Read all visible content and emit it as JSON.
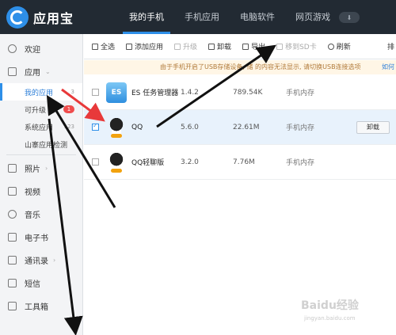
{
  "app": {
    "name": "应用宝"
  },
  "nav": {
    "tabs": [
      {
        "label": "我的手机",
        "active": true
      },
      {
        "label": "手机应用"
      },
      {
        "label": "电脑软件"
      },
      {
        "label": "网页游戏"
      }
    ],
    "download_icon": "download-icon"
  },
  "sidebar": {
    "items": [
      {
        "label": "欢迎",
        "icon": "welcome-icon"
      },
      {
        "label": "应用",
        "icon": "apps-grid-icon"
      },
      {
        "label": "照片",
        "icon": "photo-icon"
      },
      {
        "label": "视频",
        "icon": "video-icon"
      },
      {
        "label": "音乐",
        "icon": "music-icon"
      },
      {
        "label": "电子书",
        "icon": "ebook-icon"
      },
      {
        "label": "通讯录",
        "icon": "contacts-icon"
      },
      {
        "label": "短信",
        "icon": "sms-icon"
      },
      {
        "label": "工具箱",
        "icon": "toolbox-icon"
      }
    ],
    "sub_items": [
      {
        "label": "我的应用",
        "count": "3",
        "active": true
      },
      {
        "label": "可升级",
        "badge": "1"
      },
      {
        "label": "系统应用",
        "count": "123"
      },
      {
        "label": "山寨应用检测"
      }
    ]
  },
  "toolbar": {
    "select_all": "全选",
    "add_app": "添加应用",
    "upgrade": "升级",
    "uninstall": "卸载",
    "export": "导出",
    "move_sd": "移到SD卡",
    "refresh": "刷新",
    "sort": "排"
  },
  "notice": {
    "text": "由于手机开启了USB存储设备, 储                        的内容无法显示, 请切换USB连接选项",
    "link": "如何"
  },
  "apps": [
    {
      "name": "ES 任务管理器",
      "version": "1.4.2",
      "size": "789.54K",
      "location": "手机内存",
      "checked": false,
      "icon": "es-task-manager-icon"
    },
    {
      "name": "QQ",
      "version": "5.6.0",
      "size": "22.61M",
      "location": "手机内存",
      "checked": true,
      "action": "卸载",
      "icon": "qq-icon"
    },
    {
      "name": "QQ轻聊版",
      "version": "3.2.0",
      "size": "7.76M",
      "location": "手机内存",
      "checked": false,
      "icon": "qq-lite-icon"
    }
  ],
  "watermark": {
    "text": "Baidu经验",
    "sub": "jingyan.baidu.com"
  },
  "colors": {
    "topbar": "#222a33",
    "accent": "#2e8fe8",
    "badge": "#ef4c4c",
    "arrow_red": "#e8393a",
    "arrow_black": "#111111"
  }
}
